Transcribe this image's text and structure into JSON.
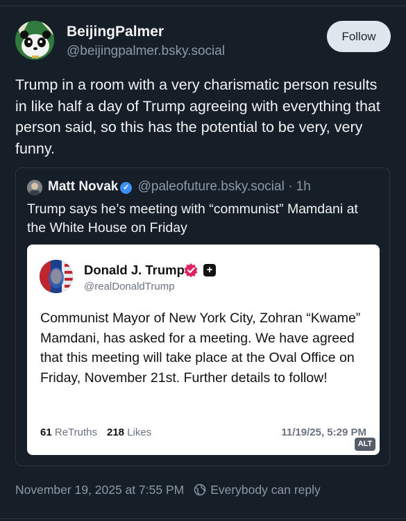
{
  "post": {
    "author_name": "BeijingPalmer",
    "author_handle": "@beijingpalmer.bsky.social",
    "follow_label": "Follow",
    "text": "Trump in a room with a very charismatic person results in like half a day of Trump agreeing with everything that person said, so this has the potential to be very, very funny.",
    "timestamp": "November 19, 2025 at 7:55 PM",
    "reply_setting": "Everybody can reply"
  },
  "quote": {
    "author_name": "Matt Novak",
    "author_handle": "@paleofuture.bsky.social",
    "time_ago": "· 1h",
    "text": "Trump says he’s meeting with “communist” Mamdani at the White House on Friday"
  },
  "truth": {
    "author_name": "Donald J. Trump",
    "author_handle": "@realDonaldTrump",
    "plus_icon": "+",
    "text": "Communist Mayor of New York City, Zohran “Kwame” Mamdani, has asked for a meeting. We have agreed that this meeting will take place at the Oval Office on Friday, November 21st. Further details to follow!",
    "retruths_count": "61",
    "retruths_label": "ReTruths",
    "likes_count": "218",
    "likes_label": "Likes",
    "date": "11/19/25, 5:29 PM",
    "alt_label": "ALT"
  },
  "colors": {
    "background": "#161e27",
    "muted_text": "#8c99a8",
    "verified_blue": "#3d8ef7",
    "truth_badge_red": "#e0245e"
  },
  "icons": {
    "verified": "verified-check-icon",
    "truth_badge": "truth-verified-icon",
    "reply_setting": "globe-icon"
  }
}
